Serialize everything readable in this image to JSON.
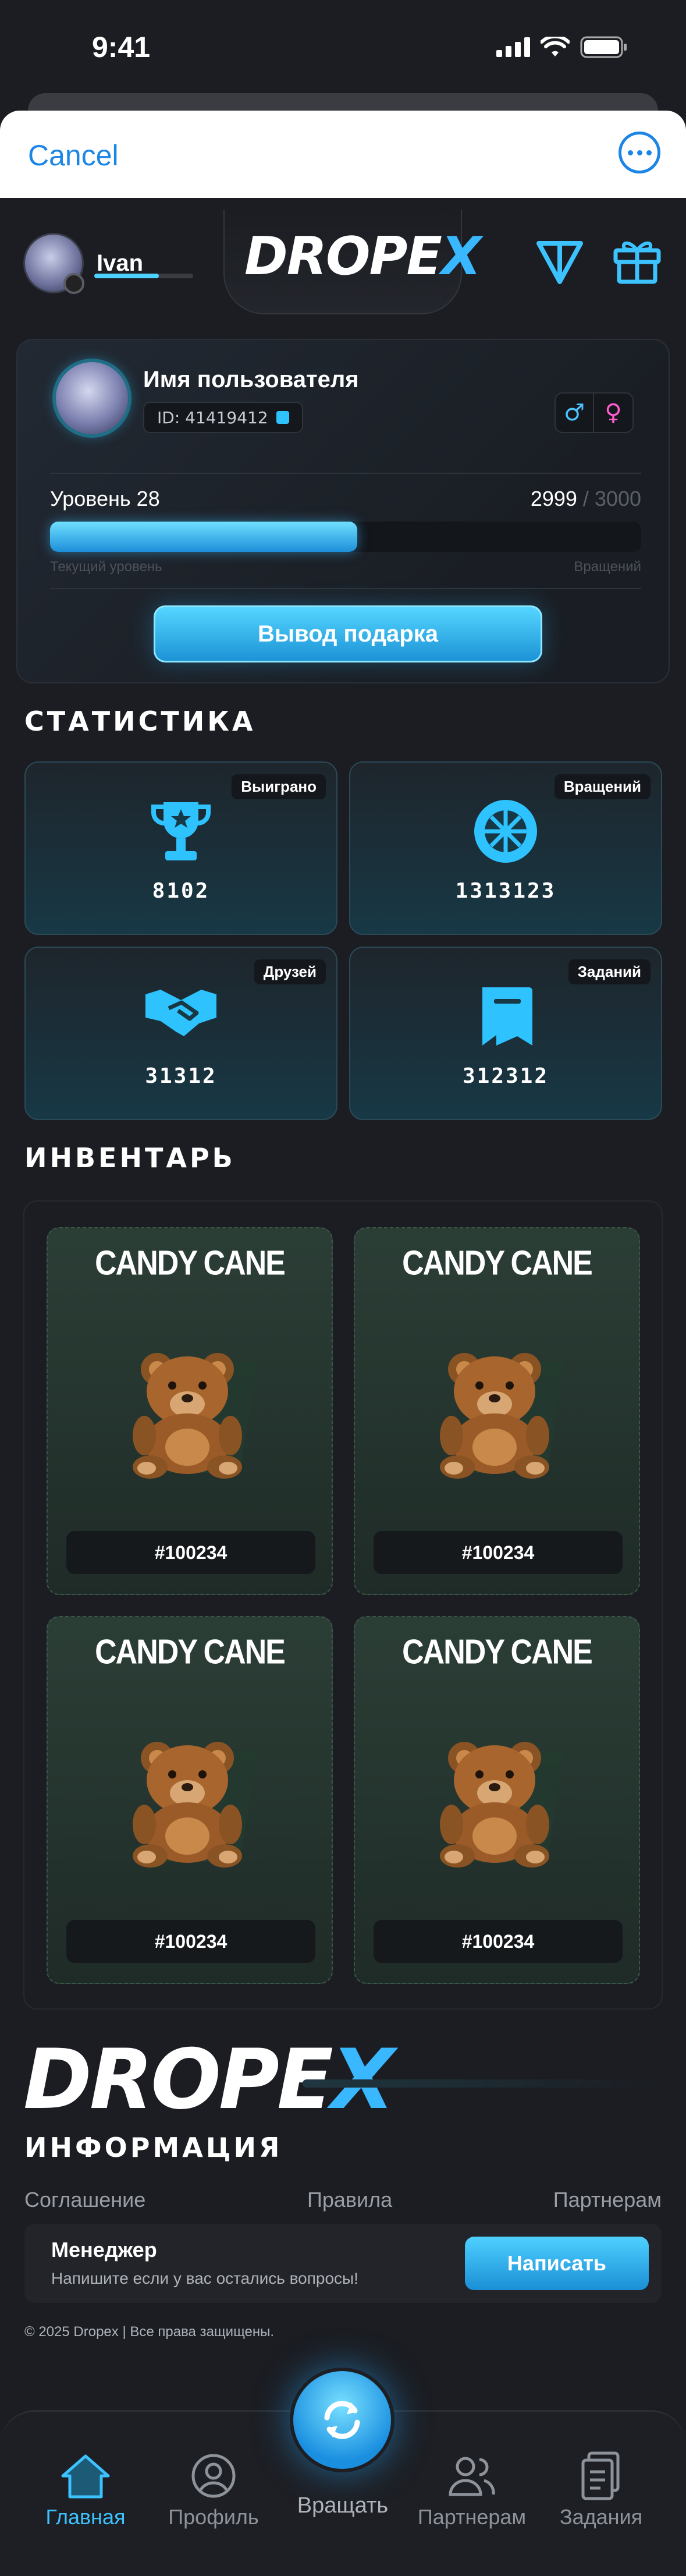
{
  "status": {
    "time": "9:41"
  },
  "tg": {
    "cancel": "Cancel"
  },
  "topnav": {
    "username": "Ivan",
    "logo_main": "DROPE",
    "logo_x": "X"
  },
  "profile": {
    "name": "Имя пользователя",
    "id": "ID: 41419412",
    "gender_male": "♂",
    "gender_female": "♀",
    "level_label": "Уровень 28",
    "spins_current": "2999",
    "spins_max": " / 3000",
    "level_progress": 0.52,
    "sub_left": "Текущий уровень",
    "sub_right": "Вращений",
    "withdraw_label": "Вывод подарка"
  },
  "stats": {
    "title": "СТАТИСТИКА",
    "items": [
      {
        "tag": "Выиграно",
        "value": "8102",
        "icon": "trophy-icon"
      },
      {
        "tag": "Вращений",
        "value": "1313123",
        "icon": "wheel-icon"
      },
      {
        "tag": "Друзей",
        "value": "31312",
        "icon": "handshake-icon"
      },
      {
        "tag": "Заданий",
        "value": "312312",
        "icon": "ticket-icon"
      }
    ]
  },
  "inventory": {
    "title": "ИНВЕНТАРЬ",
    "items": [
      {
        "name": "CANDY CANE",
        "id": "#100234"
      },
      {
        "name": "CANDY CANE",
        "id": "#100234"
      },
      {
        "name": "CANDY CANE",
        "id": "#100234"
      },
      {
        "name": "CANDY CANE",
        "id": "#100234"
      }
    ]
  },
  "footer": {
    "logo_main": "DROPE",
    "logo_x": "X",
    "info_title": "ИНФОРМАЦИЯ",
    "links": [
      "Соглашение",
      "Правила",
      "Партнерам"
    ],
    "manager_title": "Менеджер",
    "manager_sub": "Напишите если у вас остались вопросы!",
    "manager_btn": "Написать",
    "copyright": "© 2025 Dropex | Все права защищены."
  },
  "bottom_nav": {
    "items": [
      "Главная",
      "Профиль",
      "Вращать",
      "Партнерам",
      "Задания"
    ],
    "active": 0
  },
  "colors": {
    "accent": "#39b7ff",
    "bg": "#1b1d22",
    "card": "#222429"
  }
}
